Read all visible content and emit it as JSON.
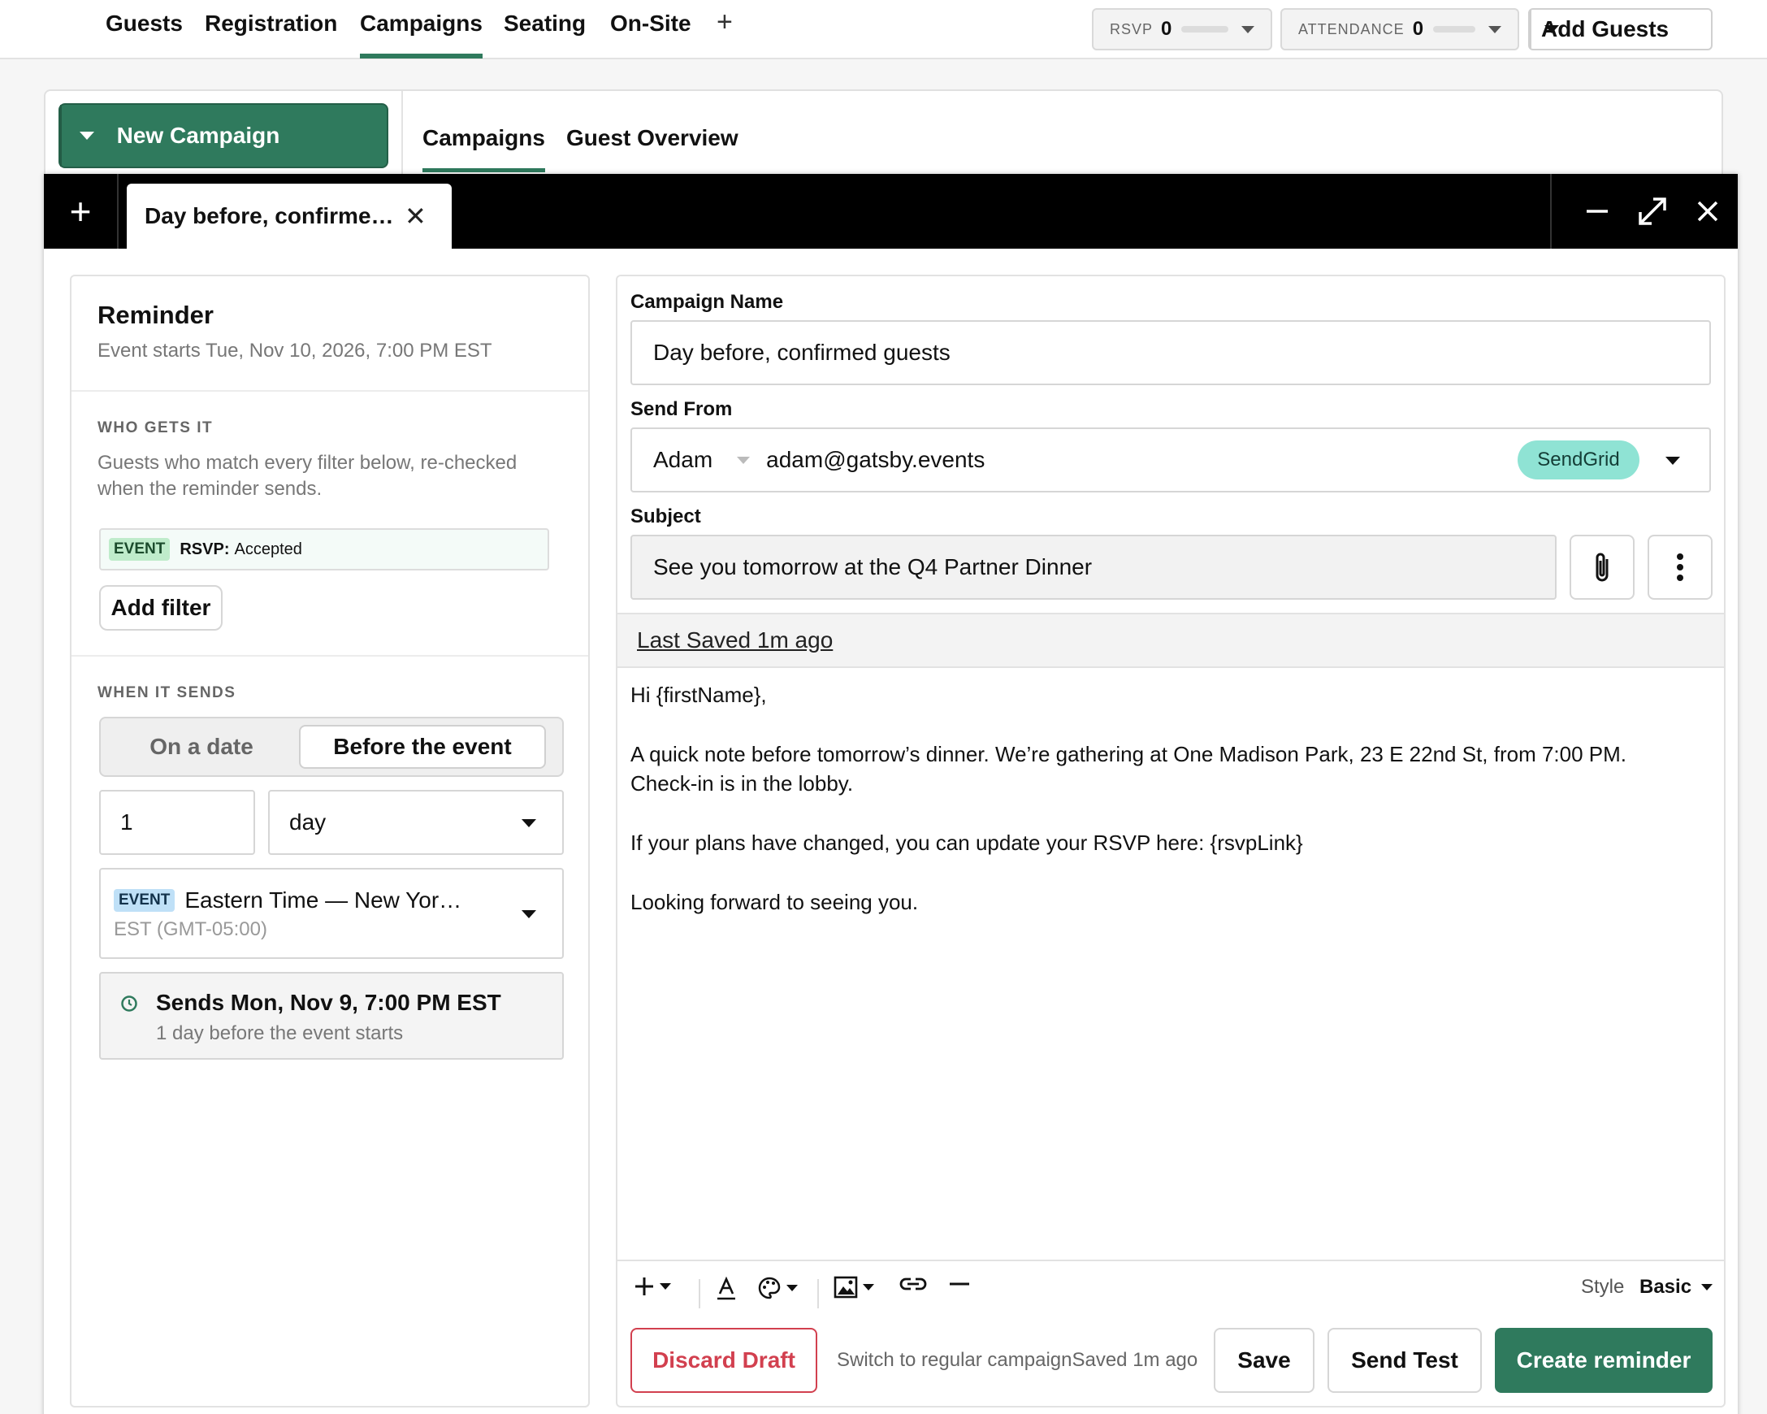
{
  "topnav": {
    "tabs": [
      "Guests",
      "Registration",
      "Campaigns",
      "Seating",
      "On-Site"
    ],
    "add": "+",
    "rsvp_label": "RSVP",
    "rsvp_count": "0",
    "attendance_label": "ATTENDANCE",
    "attendance_count": "0",
    "add_guests": "Add Guests"
  },
  "sidebar": {
    "new_campaign": "New Campaign"
  },
  "subtabs": [
    "Campaigns",
    "Guest Overview"
  ],
  "composer": {
    "add_tab": "+",
    "tab_title": "Day before, confirme…",
    "close": "✕"
  },
  "reminder": {
    "title": "Reminder",
    "event_starts": "Event starts Tue, Nov 10, 2026, 7:00 PM EST",
    "who_caption": "WHO GETS IT",
    "who_desc": "Guests who match every filter below, re-checked when the reminder sends.",
    "filter_badge": "EVENT",
    "filter_key": "RSVP:",
    "filter_value": "Accepted",
    "add_filter": "Add filter",
    "when_caption": "WHEN IT SENDS",
    "mode_options": [
      "On a date",
      "Before the event"
    ],
    "mode_selected": "Before the event",
    "offset_value": "1",
    "offset_unit": "day",
    "tz_badge": "EVENT",
    "tz_name": "Eastern Time — New Yor…",
    "tz_offset": "EST (GMT-05:00)",
    "sends_title": "Sends Mon, Nov 9, 7:00 PM EST",
    "sends_sub": "1 day before the event starts"
  },
  "email": {
    "name_label": "Campaign Name",
    "name_value": "Day before, confirmed guests",
    "from_label": "Send From",
    "from_name": "Adam",
    "from_email": "adam@gatsby.events",
    "provider": "SendGrid",
    "subject_label": "Subject",
    "subject_value": "See you tomorrow at the Q4 Partner Dinner",
    "last_saved": "Last Saved 1m ago",
    "body": [
      "Hi {firstName},",
      "A quick note before tomorrow’s dinner. We’re gathering at One Madison Park, 23 E 22nd St, from 7:00 PM.",
      "Check-in is in the lobby.",
      "If your plans have changed, you can update your RSVP here: {rsvpLink}",
      "Looking forward to seeing you."
    ],
    "style_label": "Style",
    "style_value": "Basic"
  },
  "footer": {
    "discard": "Discard Draft",
    "switch_text": "Switch to regular campaignSaved 1m ago",
    "save": "Save",
    "send_test": "Send Test",
    "create": "Create reminder"
  },
  "colors": {
    "accent": "#2f7a5d",
    "danger": "#d2404f",
    "provider_bg": "#8fe3d4"
  }
}
